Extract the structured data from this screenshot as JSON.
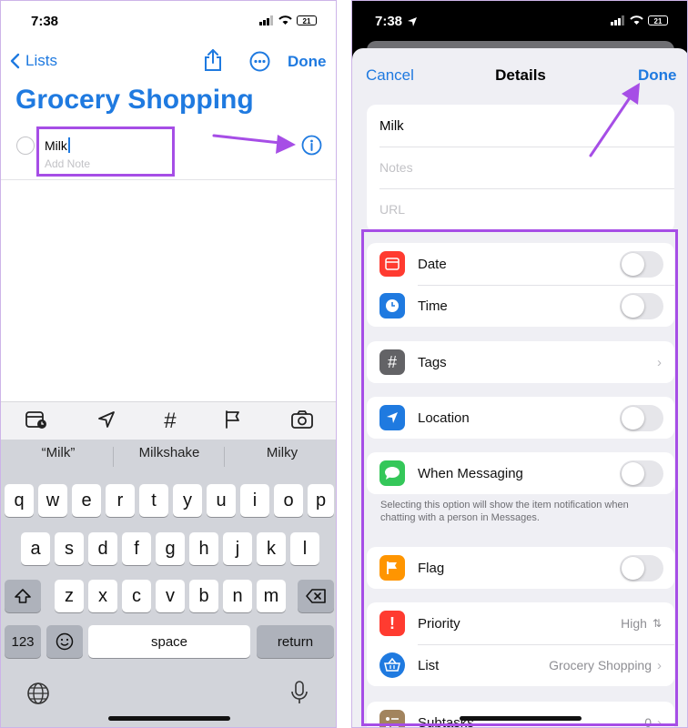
{
  "left": {
    "status": {
      "time": "7:38",
      "battery": "21"
    },
    "nav": {
      "back_label": "Lists",
      "done_label": "Done"
    },
    "list_title": "Grocery Shopping",
    "item": {
      "title": "Milk",
      "note_placeholder": "Add Note"
    },
    "suggestions": [
      "“Milk”",
      "Milkshake",
      "Milky"
    ],
    "keyboard": {
      "row1": [
        "q",
        "w",
        "e",
        "r",
        "t",
        "y",
        "u",
        "i",
        "o",
        "p"
      ],
      "row2": [
        "a",
        "s",
        "d",
        "f",
        "g",
        "h",
        "j",
        "k",
        "l"
      ],
      "row3": [
        "z",
        "x",
        "c",
        "v",
        "b",
        "n",
        "m"
      ],
      "numbers_label": "123",
      "space_label": "space",
      "return_label": "return"
    }
  },
  "right": {
    "status": {
      "time": "7:38",
      "battery": "21"
    },
    "header": {
      "cancel_label": "Cancel",
      "title": "Details",
      "done_label": "Done"
    },
    "fields": {
      "title_value": "Milk",
      "notes_placeholder": "Notes",
      "url_placeholder": "URL"
    },
    "rows": {
      "date": "Date",
      "time": "Time",
      "tags": "Tags",
      "location": "Location",
      "messaging": "When Messaging",
      "messaging_note": "Selecting this option will show the item notification when chatting with a person in Messages.",
      "flag": "Flag",
      "priority": "Priority",
      "priority_value": "High",
      "list": "List",
      "list_value": "Grocery Shopping",
      "subtasks": "Subtasks",
      "subtasks_value": "0"
    }
  },
  "colors": {
    "accent": "#1f7ae0",
    "highlight": "#a64ee6"
  }
}
